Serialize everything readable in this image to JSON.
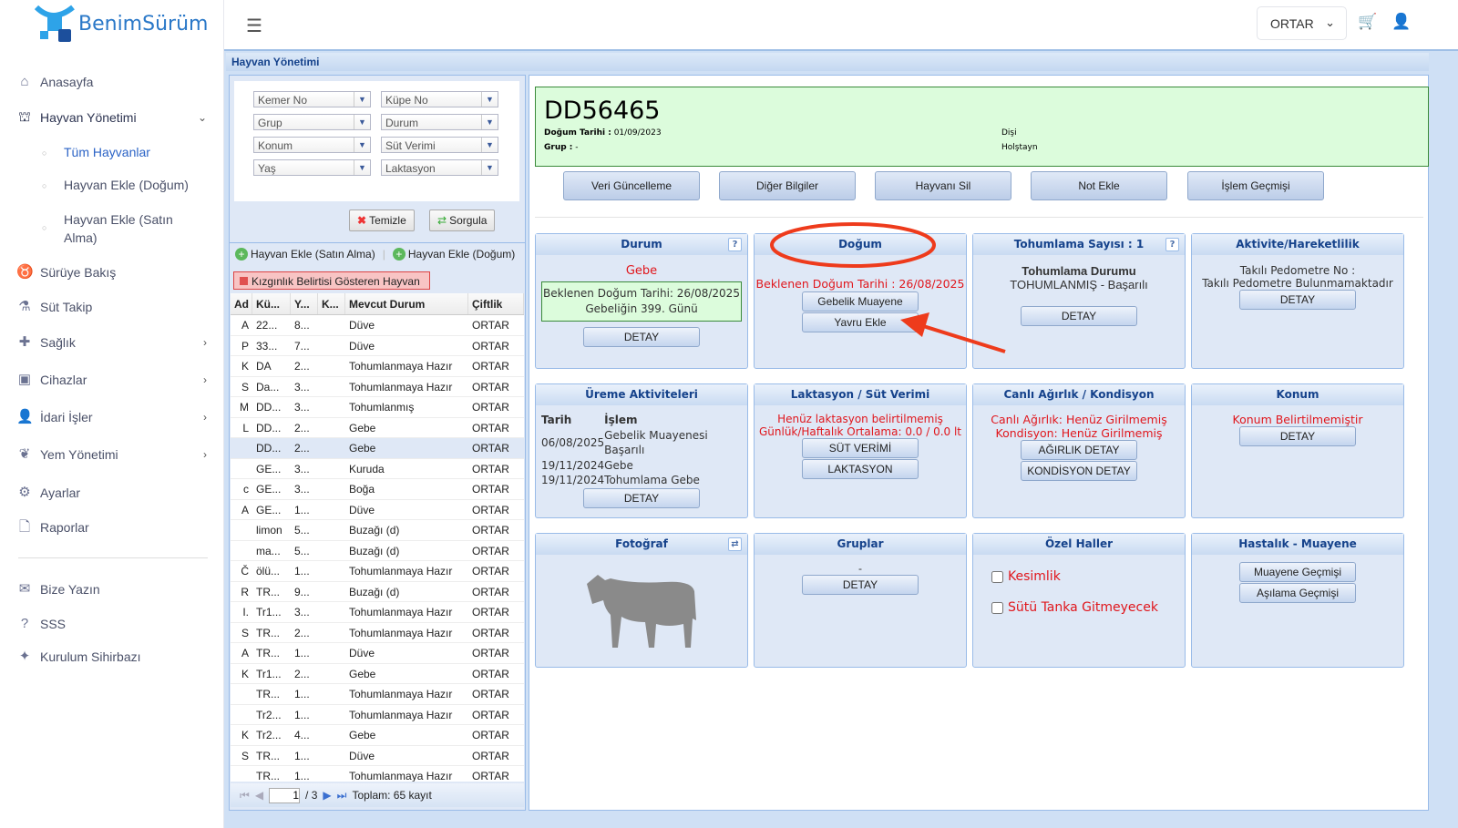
{
  "brand": {
    "name": "BenimSürüm",
    "color": "#2a78c8"
  },
  "sidebar": {
    "items": [
      {
        "label": "Anasayfa",
        "icon": "home-icon"
      },
      {
        "label": "Hayvan Yönetimi",
        "icon": "barn-icon",
        "expanded": true,
        "children": [
          {
            "label": "Tüm Hayvanlar",
            "active": true
          },
          {
            "label": "Hayvan Ekle (Doğum)"
          },
          {
            "label": "Hayvan Ekle (Satın Alma)"
          }
        ]
      },
      {
        "label": "Sürüye Bakış",
        "icon": "cow-icon"
      },
      {
        "label": "Süt Takip",
        "icon": "flask-icon"
      },
      {
        "label": "Sağlık",
        "icon": "health-hand-icon"
      },
      {
        "label": "Cihazlar",
        "icon": "devices-icon"
      },
      {
        "label": "İdari İşler",
        "icon": "user-gear-icon"
      },
      {
        "label": "Yem Yönetimi",
        "icon": "seedling-icon"
      },
      {
        "label": "Ayarlar",
        "icon": "gear-icon"
      },
      {
        "label": "Raporlar",
        "icon": "file-icon"
      },
      {
        "label": "Bize Yazın",
        "icon": "message-icon"
      },
      {
        "label": "SSS",
        "icon": "question-icon"
      },
      {
        "label": "Kurulum Sihirbazı",
        "icon": "wand-icon"
      }
    ]
  },
  "topbar": {
    "farm": "ORTAR"
  },
  "panel": {
    "title": "Hayvan Yönetimi"
  },
  "filters": [
    "Kemer No",
    "Küpe No",
    "Grup",
    "Durum",
    "Konum",
    "Süt Verimi",
    "Yaş",
    "Laktasyon"
  ],
  "filter_buttons": {
    "clear": "Temizle",
    "query": "Sorgula"
  },
  "add_links": {
    "purchase": "Hayvan Ekle (Satın Alma)",
    "birth": "Hayvan Ekle (Doğum)"
  },
  "heat_legend": "Kızgınlık Belirtisi Gösteren Hayvan",
  "grid": {
    "columns": [
      "Ad",
      "Kü...",
      "Y...",
      "K...",
      "Mevcut Durum",
      "Çiftlik"
    ],
    "rows": [
      [
        "A",
        "22...",
        "8...",
        "",
        "Düve",
        "ORTAR"
      ],
      [
        "P",
        "33...",
        "7...",
        "",
        "Düve",
        "ORTAR"
      ],
      [
        "K",
        "DA",
        "2...",
        "",
        "Tohumlanmaya Hazır",
        "ORTAR"
      ],
      [
        "S",
        "Da...",
        "3...",
        "",
        "Tohumlanmaya Hazır",
        "ORTAR"
      ],
      [
        "M",
        "DD...",
        "3...",
        "",
        "Tohumlanmış",
        "ORTAR"
      ],
      [
        "L",
        "DD...",
        "2...",
        "",
        "Gebe",
        "ORTAR"
      ],
      [
        "",
        "DD...",
        "2...",
        "",
        "Gebe",
        "ORTAR"
      ],
      [
        "",
        "GE...",
        "3...",
        "",
        "Kuruda",
        "ORTAR"
      ],
      [
        "c",
        "GE...",
        "3...",
        "",
        "Boğa",
        "ORTAR"
      ],
      [
        "A",
        "GE...",
        "1...",
        "",
        "Düve",
        "ORTAR"
      ],
      [
        "",
        "limon",
        "5...",
        "",
        "Buzağı (d)",
        "ORTAR"
      ],
      [
        "",
        "ma...",
        "5...",
        "",
        "Buzağı (d)",
        "ORTAR"
      ],
      [
        "Č",
        "ölü...",
        "1...",
        "",
        "Tohumlanmaya Hazır",
        "ORTAR"
      ],
      [
        "R",
        "TR...",
        "9...",
        "",
        "Buzağı (d)",
        "ORTAR"
      ],
      [
        "I.",
        "Tr1...",
        "3...",
        "",
        "Tohumlanmaya Hazır",
        "ORTAR"
      ],
      [
        "S",
        "TR...",
        "2...",
        "",
        "Tohumlanmaya Hazır",
        "ORTAR"
      ],
      [
        "A",
        "TR...",
        "1...",
        "",
        "Düve",
        "ORTAR"
      ],
      [
        "K",
        "Tr1...",
        "2...",
        "",
        "Gebe",
        "ORTAR"
      ],
      [
        "",
        "TR...",
        "1...",
        "",
        "Tohumlanmaya Hazır",
        "ORTAR"
      ],
      [
        "",
        "Tr2...",
        "1...",
        "",
        "Tohumlanmaya Hazır",
        "ORTAR"
      ],
      [
        "K",
        "Tr2...",
        "4...",
        "",
        "Gebe",
        "ORTAR"
      ],
      [
        "S",
        "TR...",
        "1...",
        "",
        "Düve",
        "ORTAR"
      ],
      [
        "",
        "TR...",
        "1...",
        "",
        "Tohumlanmaya Hazır",
        "ORTAR"
      ]
    ],
    "selected_row": 6
  },
  "pager": {
    "page": "1",
    "of": "/ 3",
    "total": "Toplam: 65 kayıt"
  },
  "animal": {
    "id": "DD56465",
    "birth_label": "Doğum Tarihi :",
    "birth": "01/09/2023",
    "group_label": "Grup :",
    "group": "-",
    "sex": "Dişi",
    "breed": "Holştayn"
  },
  "actions": [
    "Veri Güncelleme",
    "Diğer Bilgiler",
    "Hayvanı Sil",
    "Not Ekle",
    "İşlem Geçmişi"
  ],
  "cards": {
    "durum": {
      "title": "Durum",
      "status": "Gebe",
      "line1": "Beklenen Doğum Tarihi: 26/08/2025",
      "line2": "Gebeliğin 399. Günü",
      "btn": "DETAY"
    },
    "dogum": {
      "title": "Doğum",
      "expected": "Beklenen Doğum Tarihi : 26/08/2025",
      "btn1": "Gebelik Muayene",
      "btn2": "Yavru Ekle"
    },
    "tohum": {
      "title": "Tohumlama Sayısı : 1",
      "label": "Tohumlama Durumu",
      "value": "TOHUMLANMIŞ - Başarılı",
      "btn": "DETAY"
    },
    "aktivite": {
      "title": "Aktivite/Hareketlilik",
      "line1": "Takılı Pedometre No :",
      "line2": "Takılı Pedometre Bulunmamaktadır",
      "btn": "DETAY"
    },
    "ureme": {
      "title": "Üreme Aktiviteleri",
      "col1": "Tarih",
      "col2": "İşlem",
      "rows": [
        [
          "06/08/2025",
          "Gebelik Muayenesi Başarılı"
        ],
        [
          "19/11/2024",
          "Gebe"
        ],
        [
          "19/11/2024",
          "Tohumlama Gebe"
        ]
      ],
      "btn": "DETAY"
    },
    "laktasyon": {
      "title": "Laktasyon / Süt Verimi",
      "line1": "Henüz laktasyon belirtilmemiş",
      "line2": "Günlük/Haftalık Ortalama: 0.0 / 0.0 lt",
      "btn1": "SÜT VERİMİ",
      "btn2": "LAKTASYON"
    },
    "agirlik": {
      "title": "Canlı Ağırlık / Kondisyon",
      "line1": "Canlı Ağırlık: Henüz Girilmemiş",
      "line2": "Kondisyon: Henüz Girilmemiş",
      "btn1": "AĞIRLIK DETAY",
      "btn2": "KONDİSYON DETAY"
    },
    "konum": {
      "title": "Konum",
      "line1": "Konum Belirtilmemiştir",
      "btn": "DETAY"
    },
    "foto": {
      "title": "Fotoğraf"
    },
    "gruplar": {
      "title": "Gruplar",
      "value": "-",
      "btn": "DETAY"
    },
    "ozel": {
      "title": "Özel Haller",
      "opt1": "Kesimlik",
      "opt2": "Sütü Tanka Gitmeyecek"
    },
    "hastalik": {
      "title": "Hastalık - Muayene",
      "btn1": "Muayene Geçmişi",
      "btn2": "Aşılama Geçmişi"
    }
  },
  "colors": {
    "accent": "#15428b",
    "alert": "#e0161c",
    "annotation": "#ee3b1c",
    "header_green": "#dcfcdc"
  }
}
